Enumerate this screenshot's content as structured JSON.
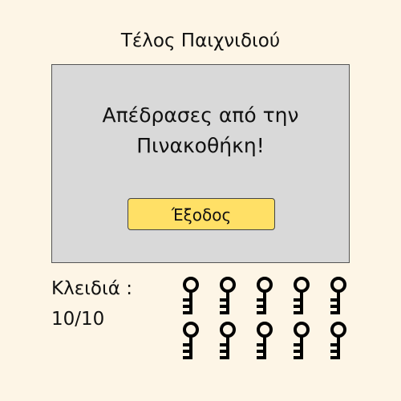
{
  "screen": {
    "title": "Τέλος Παιχνιδιού"
  },
  "dialog": {
    "message_line1": "Απέδρασες από την",
    "message_line2": "Πινακοθήκη!",
    "exit_label": "Έξοδος"
  },
  "keys": {
    "label": "Κλειδιά :",
    "count": "10/10",
    "collected": 10,
    "total": 10,
    "icon": "key-icon"
  },
  "colors": {
    "background": "#fdf5e6",
    "dialog_background": "#d9d9d9",
    "button": "#ffe066"
  }
}
